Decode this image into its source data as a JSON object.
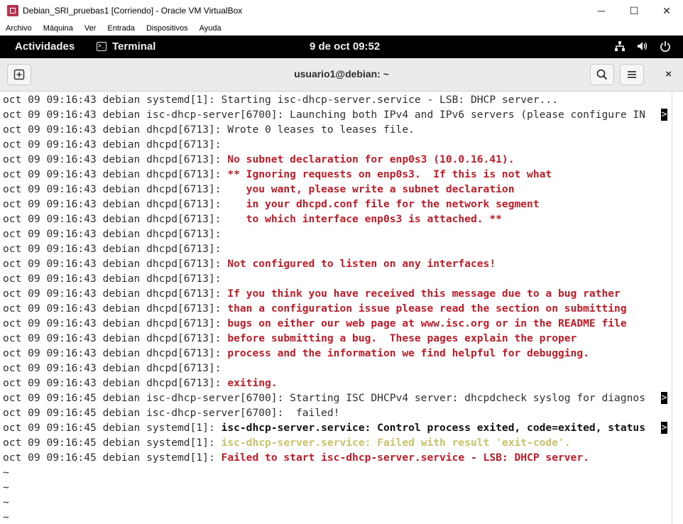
{
  "window": {
    "title": "Debian_SRI_pruebas1 [Corriendo] - Oracle VM VirtualBox",
    "minimize": "─",
    "maximize": "☐",
    "close": "✕"
  },
  "menu": [
    "Archivo",
    "Máquina",
    "Ver",
    "Entrada",
    "Dispositivos",
    "Ayuda"
  ],
  "gnome": {
    "activities": "Actividades",
    "app_name": "Terminal",
    "clock": "9 de oct  09:52"
  },
  "terminal": {
    "title": "usuario1@debian: ~",
    "close": "×",
    "lines": [
      {
        "p": "oct 09 09:16:43 debian systemd[1]: ",
        "m": "Starting isc-dhcp-server.service - LSB: DHCP server...",
        "s": "normal",
        "t": false
      },
      {
        "p": "oct 09 09:16:43 debian isc-dhcp-server[6700]: ",
        "m": "Launching both IPv4 and IPv6 servers (please configure IN",
        "s": "normal",
        "t": true
      },
      {
        "p": "oct 09 09:16:43 debian dhcpd[6713]: ",
        "m": "Wrote 0 leases to leases file.",
        "s": "normal",
        "t": false
      },
      {
        "p": "oct 09 09:16:43 debian dhcpd[6713]: ",
        "m": "",
        "s": "normal",
        "t": false
      },
      {
        "p": "oct 09 09:16:43 debian dhcpd[6713]: ",
        "m": "No subnet declaration for enp0s3 (10.0.16.41).",
        "s": "red",
        "t": false
      },
      {
        "p": "oct 09 09:16:43 debian dhcpd[6713]: ",
        "m": "** Ignoring requests on enp0s3.  If this is not what",
        "s": "red",
        "t": false
      },
      {
        "p": "oct 09 09:16:43 debian dhcpd[6713]: ",
        "m": "   you want, please write a subnet declaration",
        "s": "red",
        "t": false
      },
      {
        "p": "oct 09 09:16:43 debian dhcpd[6713]: ",
        "m": "   in your dhcpd.conf file for the network segment",
        "s": "red",
        "t": false
      },
      {
        "p": "oct 09 09:16:43 debian dhcpd[6713]: ",
        "m": "   to which interface enp0s3 is attached. **",
        "s": "red",
        "t": false
      },
      {
        "p": "oct 09 09:16:43 debian dhcpd[6713]: ",
        "m": "",
        "s": "normal",
        "t": false
      },
      {
        "p": "oct 09 09:16:43 debian dhcpd[6713]: ",
        "m": "",
        "s": "normal",
        "t": false
      },
      {
        "p": "oct 09 09:16:43 debian dhcpd[6713]: ",
        "m": "Not configured to listen on any interfaces!",
        "s": "red",
        "t": false
      },
      {
        "p": "oct 09 09:16:43 debian dhcpd[6713]: ",
        "m": "",
        "s": "normal",
        "t": false
      },
      {
        "p": "oct 09 09:16:43 debian dhcpd[6713]: ",
        "m": "If you think you have received this message due to a bug rather",
        "s": "red",
        "t": false
      },
      {
        "p": "oct 09 09:16:43 debian dhcpd[6713]: ",
        "m": "than a configuration issue please read the section on submitting",
        "s": "red",
        "t": false
      },
      {
        "p": "oct 09 09:16:43 debian dhcpd[6713]: ",
        "m": "bugs on either our web page at www.isc.org or in the README file",
        "s": "red",
        "t": false
      },
      {
        "p": "oct 09 09:16:43 debian dhcpd[6713]: ",
        "m": "before submitting a bug.  These pages explain the proper",
        "s": "red",
        "t": false
      },
      {
        "p": "oct 09 09:16:43 debian dhcpd[6713]: ",
        "m": "process and the information we find helpful for debugging.",
        "s": "red",
        "t": false
      },
      {
        "p": "oct 09 09:16:43 debian dhcpd[6713]: ",
        "m": "",
        "s": "normal",
        "t": false
      },
      {
        "p": "oct 09 09:16:43 debian dhcpd[6713]: ",
        "m": "exiting.",
        "s": "red",
        "t": false
      },
      {
        "p": "oct 09 09:16:45 debian isc-dhcp-server[6700]: ",
        "m": "Starting ISC DHCPv4 server: dhcpdcheck syslog for diagnos",
        "s": "normal",
        "t": true
      },
      {
        "p": "oct 09 09:16:45 debian isc-dhcp-server[6700]: ",
        "m": " failed!",
        "s": "normal",
        "t": false
      },
      {
        "p": "oct 09 09:16:45 debian systemd[1]: ",
        "m": "isc-dhcp-server.service: Control process exited, code=exited, status",
        "s": "bold",
        "t": true
      },
      {
        "p": "oct 09 09:16:45 debian systemd[1]: ",
        "m": "isc-dhcp-server.service: Failed with result 'exit-code'.",
        "s": "yellow",
        "t": false
      },
      {
        "p": "oct 09 09:16:45 debian systemd[1]: ",
        "m": "Failed to start isc-dhcp-server.service - LSB: DHCP server.",
        "s": "red",
        "t": false
      }
    ],
    "truncation_marker": ">",
    "tildes": [
      "~",
      "~",
      "~",
      "~"
    ]
  },
  "colors": {
    "error_red": "#c01c28",
    "warning_yellow": "#c9c26a",
    "topbar": "#000000"
  }
}
